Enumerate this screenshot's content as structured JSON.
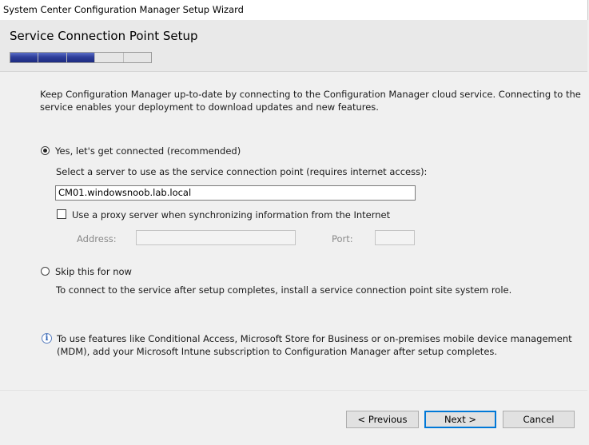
{
  "window": {
    "title": "System Center Configuration Manager Setup Wizard"
  },
  "header": {
    "title": "Service Connection Point Setup"
  },
  "progress": {
    "total_steps": 5,
    "completed_steps": 3,
    "accent": "#2e3e9a"
  },
  "intro": {
    "line1": "Keep Configuration Manager up-to-date by connecting to the Configuration Manager cloud service. Connecting to the",
    "line2": "service enables your deployment to download updates and new features."
  },
  "options": {
    "connect": {
      "label": "Yes, let's get connected (recommended)",
      "selected": true
    },
    "server_prompt": "Select a server to use as the service connection point (requires internet access):",
    "server_value": "CM01.windowsnoob.lab.local",
    "proxy": {
      "label": "Use a proxy server when synchronizing information from the Internet",
      "checked": false
    },
    "address_label": "Address:",
    "address_value": "",
    "port_label": "Port:",
    "port_value": "",
    "skip": {
      "label": "Skip this for now",
      "selected": false
    },
    "skip_note": "To connect to the service after setup completes, install a service connection point site system role."
  },
  "info": {
    "icon": "info-icon",
    "line1": "To use features like Conditional Access, Microsoft Store for Business or on-premises mobile device management",
    "line2": "(MDM), add your Microsoft Intune subscription to Configuration Manager after setup completes."
  },
  "buttons": {
    "previous": "< Previous",
    "next": "Next >",
    "cancel": "Cancel"
  }
}
